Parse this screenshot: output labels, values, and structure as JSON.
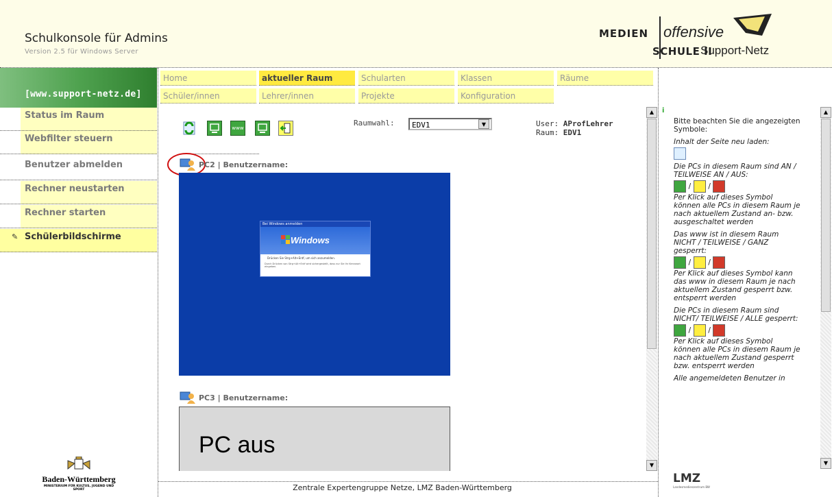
{
  "header": {
    "title": "Schulkonsole für Admins",
    "version": "Version 2.5 für Windows Server",
    "logo": {
      "medien": "MEDIEN",
      "offensive": "offensive",
      "schule": "SCHULE II",
      "support": "Support-Netz"
    }
  },
  "sidebar": {
    "site_link": "[www.support-netz.de]",
    "items": [
      {
        "label": "Status im Raum"
      },
      {
        "label": "Webfilter steuern"
      },
      {
        "label": "Benutzer abmelden"
      },
      {
        "label": "Rechner neustarten"
      },
      {
        "label": "Rechner starten"
      },
      {
        "label": "Schülerbildschirme"
      }
    ],
    "footer_logo": {
      "name": "Baden-Württemberg",
      "sub": "MINISTERIUM FÜR KULTUS, JUGEND UND SPORT"
    }
  },
  "nav": {
    "row1": [
      "Home",
      "aktueller Raum",
      "Schularten",
      "Klassen",
      "Räume"
    ],
    "row2": [
      "Schüler/innen",
      "Lehrer/innen",
      "Projekte",
      "Konfiguration"
    ],
    "active": "aktueller Raum"
  },
  "toolbar": {
    "raumwahl_label": "Raumwahl:",
    "raum_selected": "EDV1",
    "user_label": "User:",
    "user_value": "AProfLehrer",
    "raum_label": "Raum:",
    "raum_value": "EDV1",
    "www_text": "www"
  },
  "pcs": [
    {
      "label": "PC2 | Benutzername:",
      "screen": "windows-login"
    },
    {
      "label": "PC3 | Benutzername:",
      "screen_text": "PC aus"
    }
  ],
  "dialog": {
    "title": "Bei Windows anmelden",
    "brand": "Windows",
    "text1": "Drücken Sie Strg+Alt+Entf, um sich anzumelden.",
    "text2": "Durch Drücken von Strg+Alt+Entf wird sichergestellt, dass nur Sie Ihr Kennwort eingeben."
  },
  "help": {
    "intro": "Bitte beachten Sie die angezeigten Symbole:",
    "reload": "Inhalt der Seite neu laden:",
    "pcs_on": "Die PCs in diesem Raum sind AN / TEILWEISE AN / AUS:",
    "pcs_on_click": "Per Klick auf dieses Symbol können alle PCs in diesem Raum je nach aktuellem Zustand an- bzw. ausgeschaltet werden",
    "www_status": "Das www ist in diesem Raum NICHT / TEILWEISE / GANZ gesperrt:",
    "www_click": "Per Klick auf dieses Symbol kann das www in diesem Raum je nach aktuellem Zustand gesperrt bzw. entsperrt werden",
    "pcs_locked": "Die PCs in diesem Raum sind NICHT/ TEILWEISE / ALLE gesperrt:",
    "pcs_locked_click": "Per Klick auf dieses Symbol können alle PCs in diesem Raum je nach aktuellem Zustand gesperrt bzw. entsperrt werden",
    "logged_in": "Alle angemeldeten Benutzer in",
    "separator": "/"
  },
  "footer": {
    "text": "Zentrale Expertengruppe Netze, LMZ Baden-Württemberg",
    "lmz": "LMZ",
    "lmz_sub": "Landesmedienzentrum BW"
  },
  "colors": {
    "header_bg": "#fefde8",
    "nav_bg": "#ffffa8",
    "nav_active": "#ffea40",
    "sidebar_green": "#4fa24f",
    "screen_blue": "#0b3da8"
  }
}
